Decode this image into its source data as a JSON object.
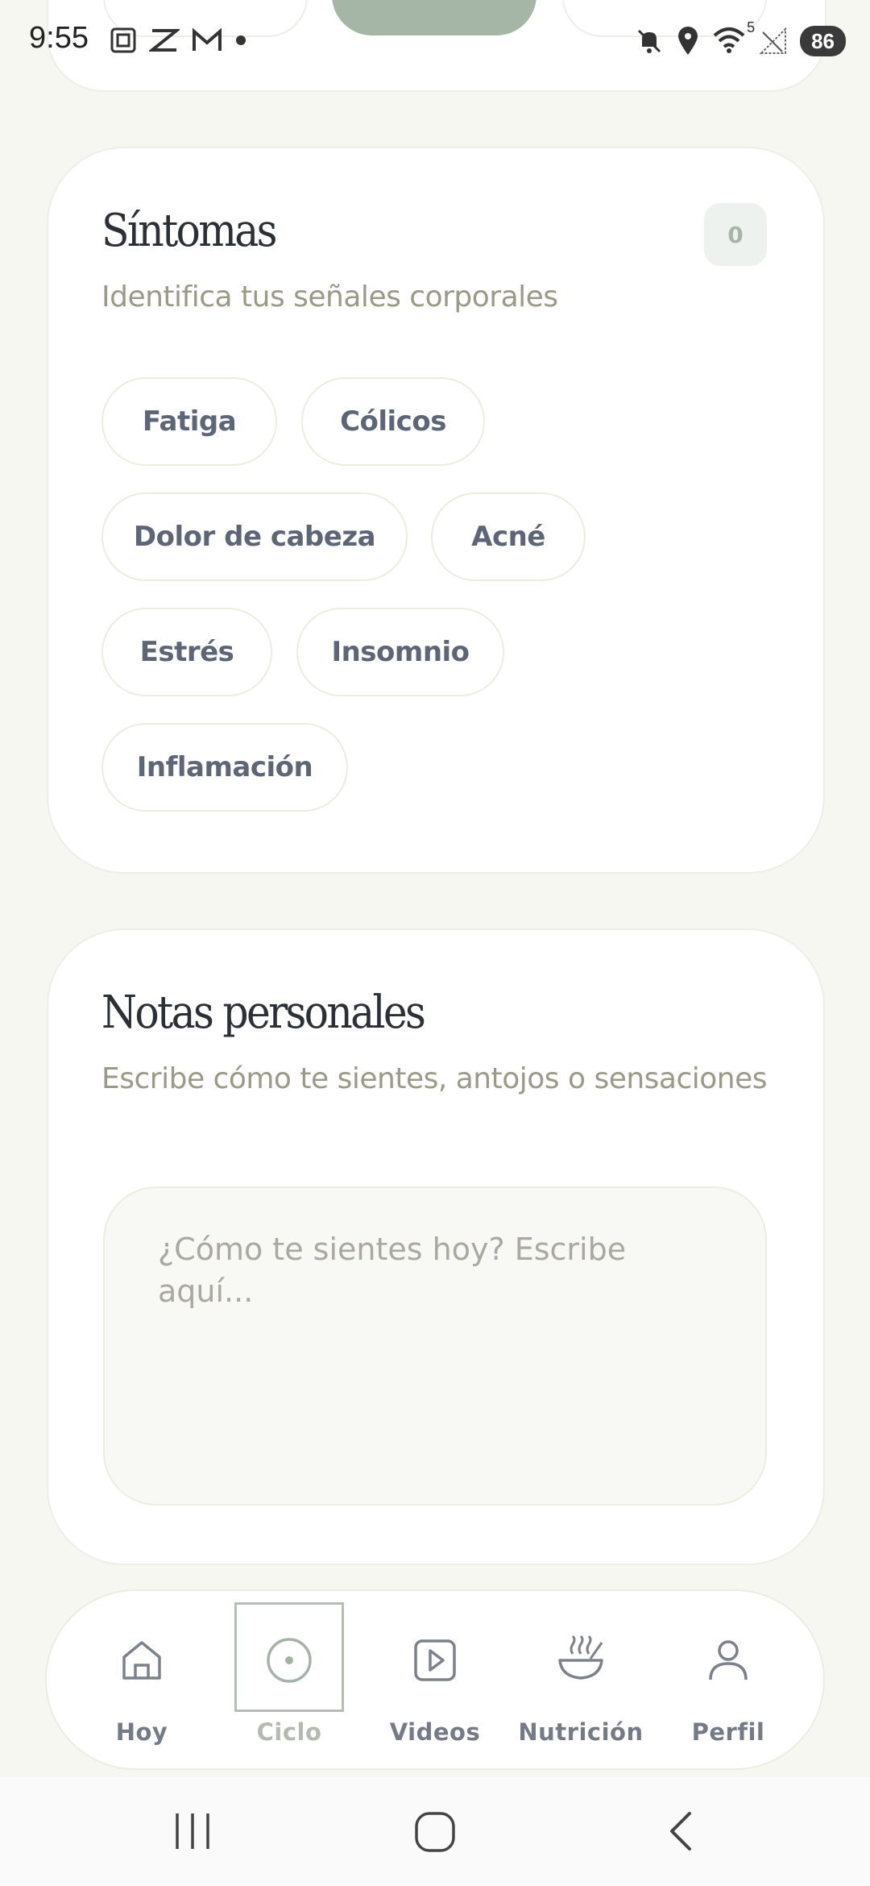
{
  "status_bar": {
    "time": "9:55",
    "left_icons": [
      "screenshot-icon",
      "capcut-icon",
      "gmail-icon",
      "dot-icon"
    ],
    "right_icons": [
      "mute-icon",
      "location-icon",
      "wifi-icon",
      "signal-icon"
    ],
    "wifi_badge": "5",
    "battery": "86"
  },
  "sintomas": {
    "title": "Síntomas",
    "subtitle": "Identifica tus señales corporales",
    "count": "0",
    "chips": [
      "Fatiga",
      "Cólicos",
      "Dolor de cabeza",
      "Acné",
      "Estrés",
      "Insomnio",
      "Inflamación"
    ]
  },
  "notas": {
    "title": "Notas personales",
    "subtitle": "Escribe cómo te sientes, antojos o sensaciones",
    "placeholder": "¿Cómo te sientes hoy? Escribe aquí..."
  },
  "bottom_nav": {
    "active": "Ciclo",
    "items": [
      {
        "label": "Hoy",
        "icon": "home-icon"
      },
      {
        "label": "Ciclo",
        "icon": "cycle-icon"
      },
      {
        "label": "Videos",
        "icon": "video-icon"
      },
      {
        "label": "Nutrición",
        "icon": "bowl-icon"
      },
      {
        "label": "Perfil",
        "icon": "user-icon"
      }
    ]
  },
  "colors": {
    "background": "#f7f7f2",
    "accent_sage": "#a5b5a6",
    "text_primary": "#2b2f36",
    "text_muted": "#9a9a87"
  }
}
